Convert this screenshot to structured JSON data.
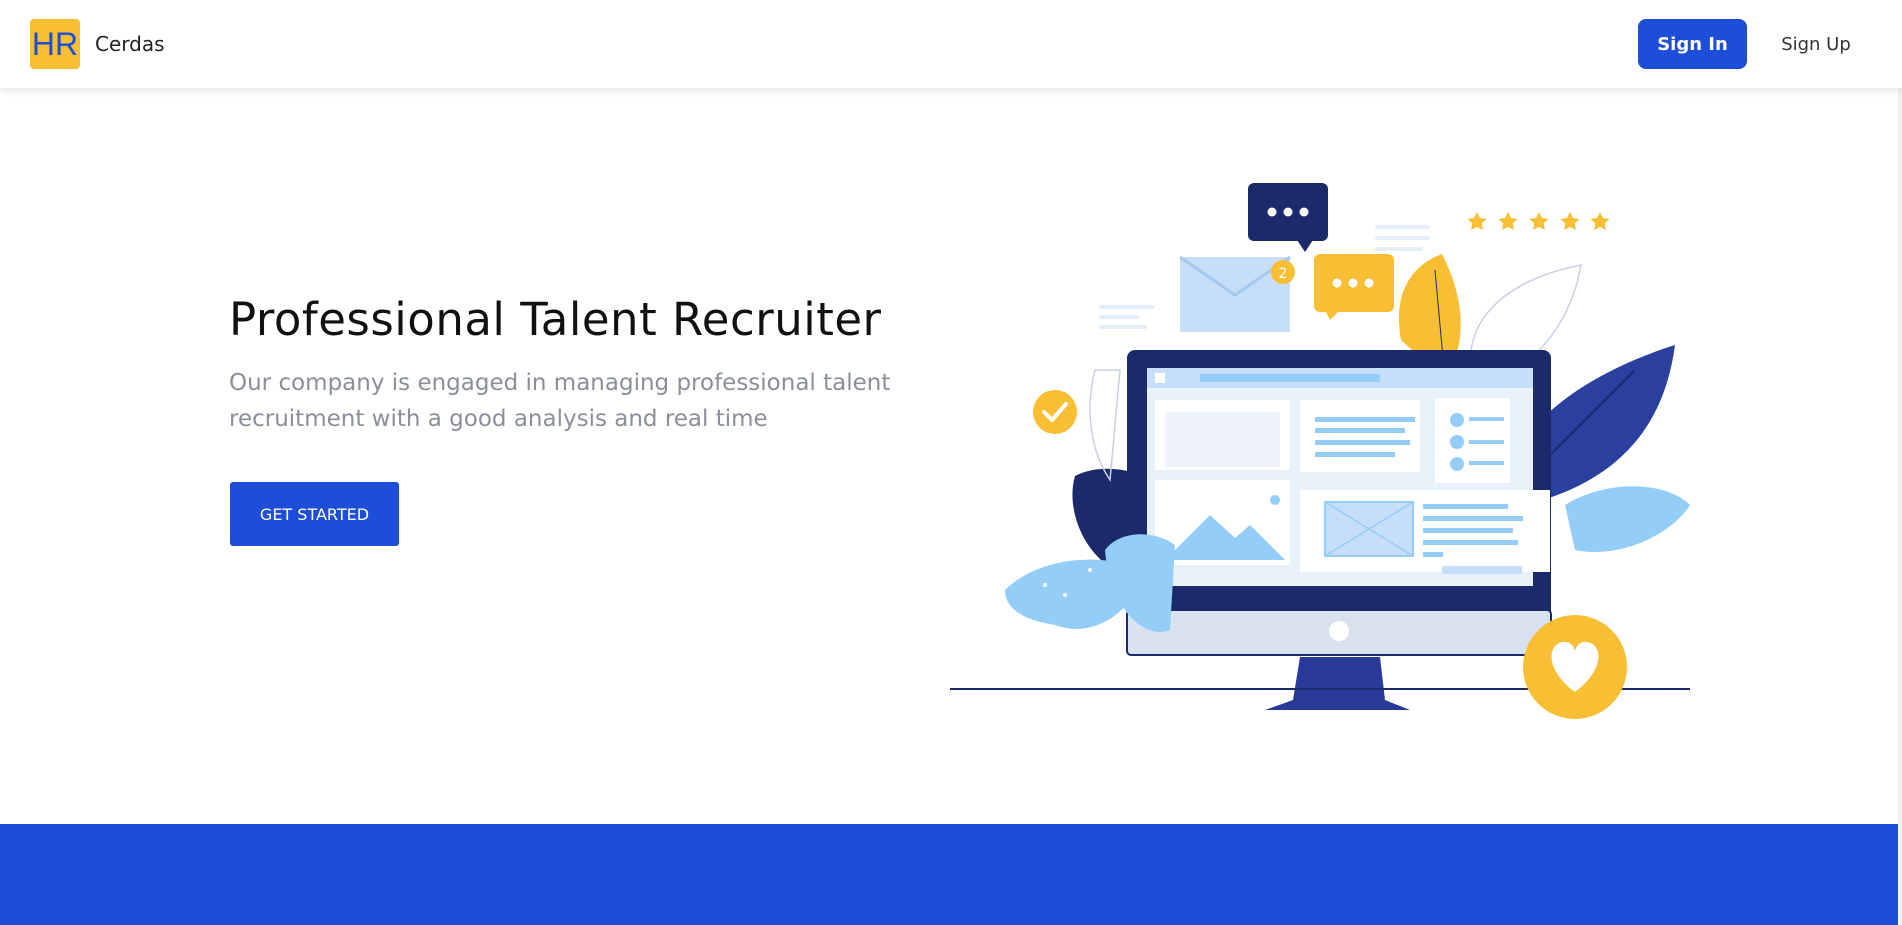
{
  "nav": {
    "brand": "Cerdas",
    "logo_text": "HR",
    "sign_in": "Sign In",
    "sign_up": "Sign Up"
  },
  "hero": {
    "title": "Professional Talent Recruiter",
    "description": "Our company is engaged in managing professional talent recruitment with a good analysis and real time",
    "cta": "GET STARTED"
  },
  "illustration": {
    "notification_count": "2"
  },
  "colors": {
    "primary": "#1e4ed8",
    "accent": "#f8bf35",
    "navy": "#1b2a6b",
    "light_blue": "#93cdf8"
  }
}
